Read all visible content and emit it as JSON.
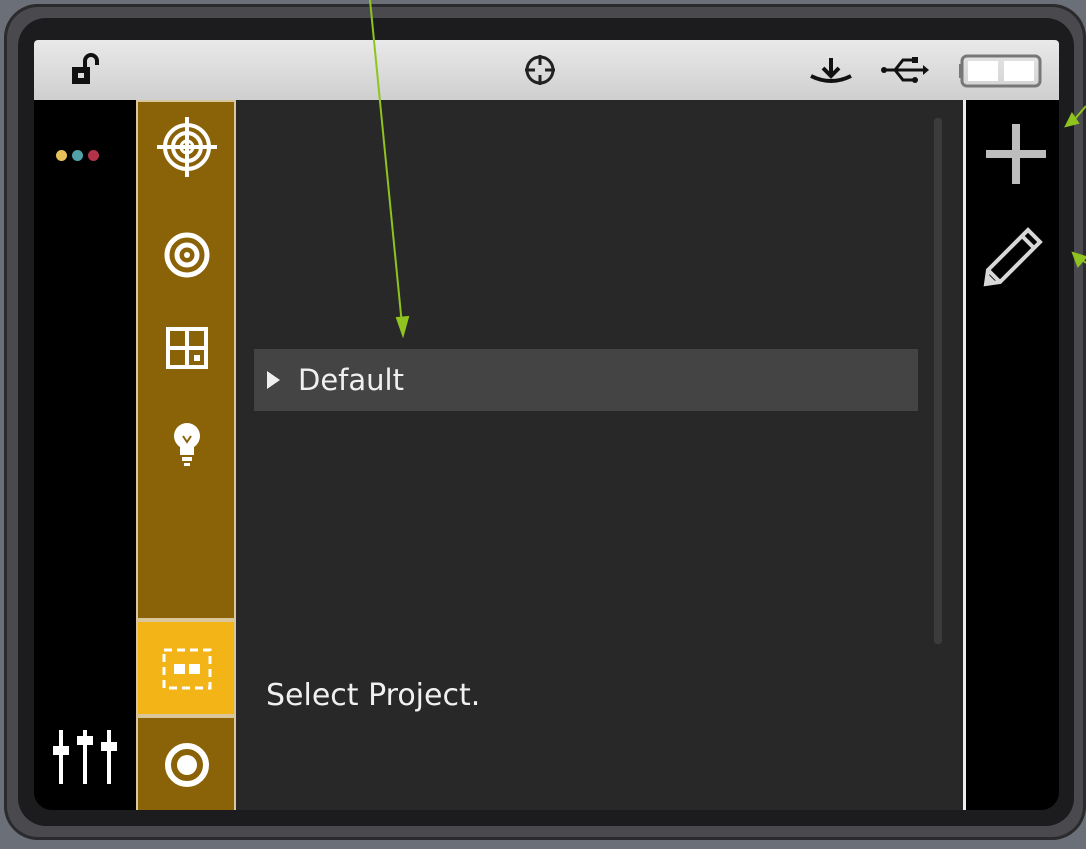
{
  "status_bar": {
    "icons": [
      "unlocked-padlock-icon",
      "crosshair-icon",
      "antenna-icon",
      "usb-icon",
      "battery-icon"
    ]
  },
  "left_strip": {
    "dot_colors": [
      "#e6c15a",
      "#4fa3a8",
      "#b3344a"
    ],
    "icons": [
      "more-dots-icon",
      "mixer-sliders-icon"
    ]
  },
  "menu": {
    "items": [
      "target-icon",
      "concentric-circles-icon",
      "grid-layout-icon",
      "lightbulb-icon"
    ],
    "active_item": "dashed-frame-icon",
    "bottom_item": "ring-icon"
  },
  "content": {
    "list": [
      {
        "label": "Default"
      }
    ],
    "status_message": "Select Project."
  },
  "actions": {
    "items": [
      "add-icon",
      "edit-pencil-icon"
    ]
  },
  "colors": {
    "menu_gold": "#8a6208",
    "active_gold": "#f3b418",
    "annotation_green": "#8fc31f",
    "content_bg": "#282828"
  }
}
